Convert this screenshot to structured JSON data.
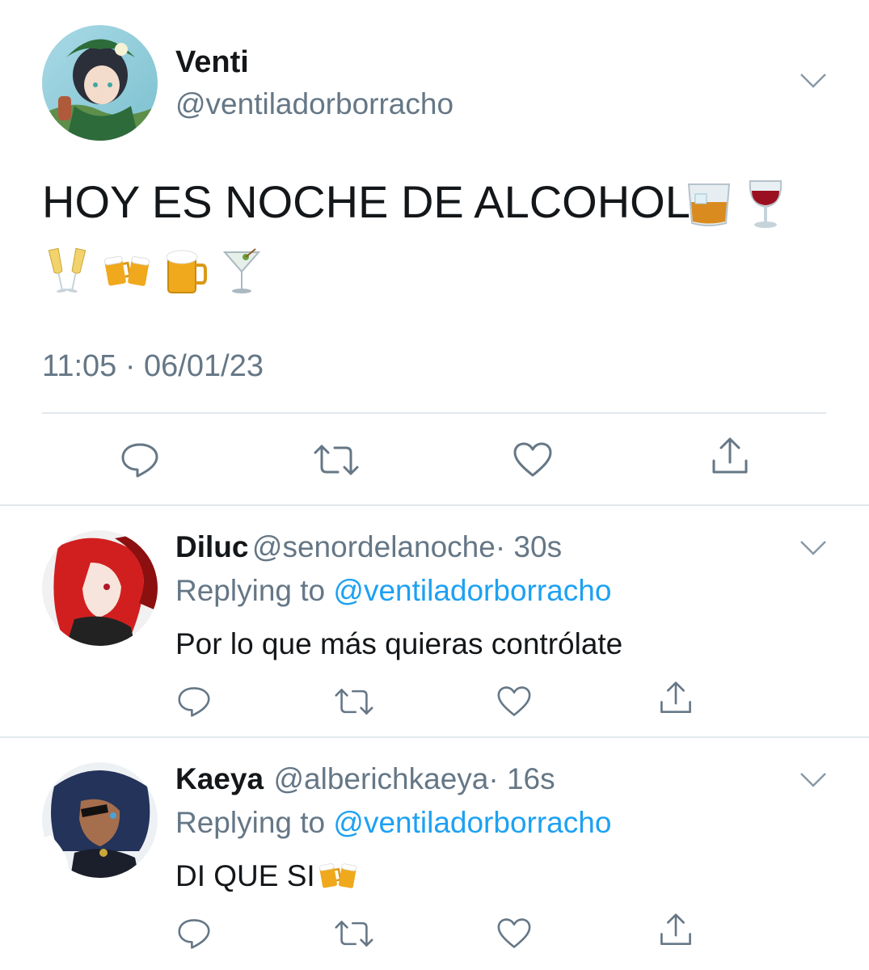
{
  "main_tweet": {
    "name": "Venti",
    "handle": "@ventiladorborracho",
    "text": "HOY ES NOCHE DE ALCOHOL",
    "emojis_line1": [
      "tumbler-glass-icon",
      "wine-glass-icon"
    ],
    "emojis_line2": [
      "clinking-glasses-icon",
      "clinking-beers-icon",
      "beer-mug-icon",
      "cocktail-glass-icon"
    ],
    "timestamp": "11:05 · 06/01/23",
    "actions": [
      "reply-icon",
      "retweet-icon",
      "like-icon",
      "share-icon"
    ]
  },
  "replies": [
    {
      "name": "Diluc",
      "handle": "@senordelanoche",
      "age": "· 30s",
      "replying_prefix": "Replying to",
      "replying_handle": "@ventiladorborracho",
      "text": "Por lo que más quieras contrólate"
    },
    {
      "name": "Kaeya",
      "handle": "@alberichkaeya",
      "age": "· 16s",
      "replying_prefix": "Replying to",
      "replying_handle": "@ventiladorborracho",
      "text": "DI QUE SI",
      "emoji": "clinking-beers-icon"
    }
  ],
  "colors": {
    "text": "#14171a",
    "secondary": "#657786",
    "link": "#1da1f2",
    "divider": "#e1e8ed"
  }
}
